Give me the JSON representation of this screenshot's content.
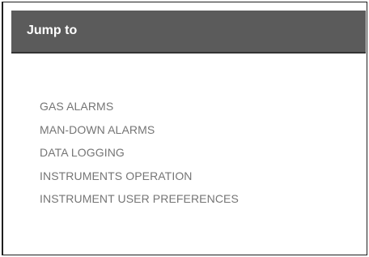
{
  "jump_panel": {
    "title": "Jump to",
    "links": [
      {
        "label": "GAS ALARMS"
      },
      {
        "label": "MAN-DOWN ALARMS"
      },
      {
        "label": "DATA LOGGING"
      },
      {
        "label": "INSTRUMENTS OPERATION"
      },
      {
        "label": "INSTRUMENT USER PREFERENCES"
      }
    ]
  },
  "colors": {
    "header_background": "#5b5b5b",
    "header_text": "#ffffff",
    "link_text": "#757575",
    "panel_border": "#1f1f1f",
    "page_background": "#ffffff"
  }
}
